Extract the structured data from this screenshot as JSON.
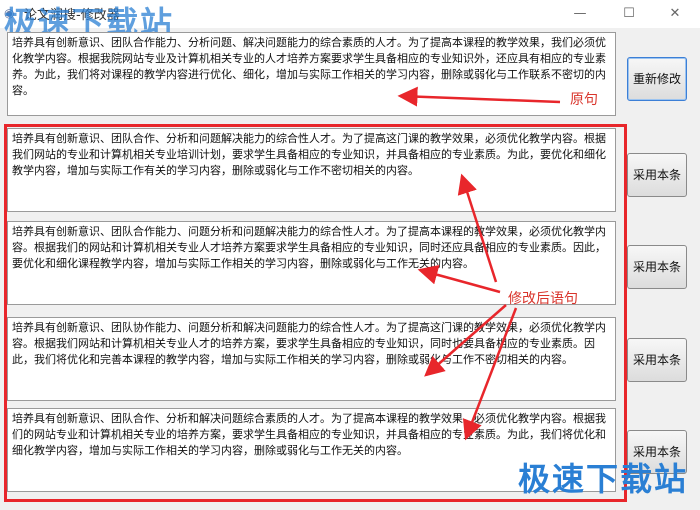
{
  "window": {
    "title": "论文润搜-修改器",
    "min_icon": "minimize-icon",
    "max_icon": "maximize-icon",
    "close_icon": "close-icon"
  },
  "watermark": {
    "top": "极速下载站",
    "bottom": "极速下载站"
  },
  "original": {
    "text": "培养具有创新意识、团队合作能力、分析问题、解决问题能力的综合素质的人才。为了提高本课程的教学效果，我们必须优化教学内容。根据我院网站专业及计算机相关专业的人才培养方案要求学生具备相应的专业知识外，还应具有相应的专业素养。为此，我们将对课程的教学内容进行优化、细化，增加与实际工作相关的学习内容，删除或弱化与工作联系不密切的内容。",
    "button": "重新修改"
  },
  "suggestions": [
    {
      "text": "培养具有创新意识、团队合作、分析和问题解决能力的综合性人才。为了提高这门课的教学效果，必须优化教学内容。根据我们网站的专业和计算机相关专业培训计划，要求学生具备相应的专业知识，并具备相应的专业素质。为此，要优化和细化教学内容，增加与实际工作有关的学习内容，删除或弱化与工作不密切相关的内容。",
      "button": "采用本条"
    },
    {
      "text": "培养具有创新意识、团队合作能力、问题分析和问题解决能力的综合性人才。为了提高本课程的教学效果，必须优化教学内容。根据我们的网站和计算机相关专业人才培养方案要求学生具备相应的专业知识，同时还应具备相应的专业素质。因此，要优化和细化课程教学内容，增加与实际工作相关的学习内容，删除或弱化与工作无关的内容。",
      "button": "采用本条"
    },
    {
      "text": "培养具有创新意识、团队协作能力、问题分析和解决问题能力的综合性人才。为了提高这门课的教学效果，必须优化教学内容。根据我们网站和计算机相关专业人才的培养方案，要求学生具备相应的专业知识，同时也要具备相应的专业素质。因此，我们将优化和完善本课程的教学内容，增加与实际工作相关的学习内容，删除或弱化与工作不密切相关的内容。",
      "button": "采用本条"
    },
    {
      "text": "培养具有创新意识、团队合作、分析和解决问题综合素质的人才。为了提高本课程的教学效果，必须优化教学内容。根据我们的网站专业和计算机相关专业的培养方案，要求学生具备相应的专业知识，并具备相应的专业素质。为此，我们将优化和细化教学内容，增加与实际工作相关的学习内容，删除或弱化与工作无关的内容。",
      "button": "采用本条"
    }
  ],
  "annotations": {
    "original_label": "原句",
    "revised_label": "修改后语句"
  },
  "colors": {
    "annotation": "#e8262b",
    "watermark": "#2a7fd4"
  }
}
